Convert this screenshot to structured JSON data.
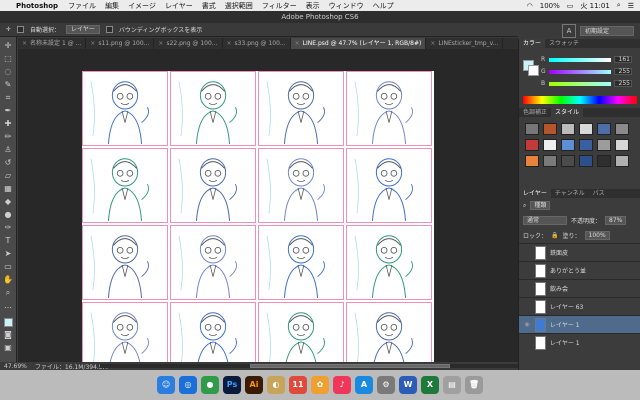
{
  "menubar": {
    "app": "Photoshop",
    "items": [
      "ファイル",
      "編集",
      "イメージ",
      "レイヤー",
      "書式",
      "選択範囲",
      "フィルター",
      "表示",
      "ウィンドウ",
      "ヘルプ"
    ],
    "battery": "100%",
    "clock": "火 11:01"
  },
  "window": {
    "title": "Adobe Photoshop CS6"
  },
  "options": {
    "auto_select_label": "自動選択：",
    "auto_select_value": "レイヤー",
    "bbox_label": "バウンディングボックスを表示",
    "workspace": "初期設定"
  },
  "tabs": [
    {
      "label": "名称未設定 1 @ ..."
    },
    {
      "label": "s11.png @ 100..."
    },
    {
      "label": "s22.png @ 100..."
    },
    {
      "label": "s33.png @ 100..."
    },
    {
      "label": "LINE.psd @ 47.7% (レイヤー 1, RGB/8#)"
    },
    {
      "label": "LINEsticker_tmp_v..."
    }
  ],
  "status": {
    "zoom": "47.69%",
    "file": "ファイル：16.1M/394.5M"
  },
  "color_panel": {
    "tabs": [
      "カラー",
      "スウォッチ"
    ],
    "r": {
      "label": "R",
      "value": "161"
    },
    "g": {
      "label": "G",
      "value": "255"
    },
    "b": {
      "label": "B",
      "value": "255"
    },
    "fg_color": "#c9f3f8"
  },
  "adjust_panel": {
    "tabs": [
      "色調補正",
      "スタイル"
    ]
  },
  "layers_panel": {
    "tabs": [
      "レイヤー",
      "チャンネル",
      "パス"
    ],
    "filter": "種類",
    "blend": "通常",
    "opacity_label": "不透明度：",
    "opacity": "87%",
    "lock_label": "ロック：",
    "fill_label": "塗り：",
    "fill": "100%",
    "layers": [
      {
        "name": "鉄面皮",
        "selected": false
      },
      {
        "name": "ありがとう並",
        "selected": false
      },
      {
        "name": "飲み会",
        "selected": false
      },
      {
        "name": "レイヤー 63",
        "selected": false
      },
      {
        "name": "レイヤー 1",
        "selected": true
      },
      {
        "name": "レイヤー 1",
        "selected": false
      }
    ]
  },
  "dock": [
    "Finder",
    "Safari",
    "Chrome",
    "Ps",
    "Ai",
    "Preview",
    "Calendar",
    "Photos",
    "Music",
    "App Store",
    "Prefs",
    "Word",
    "Excel",
    "Folder",
    "Trash"
  ]
}
